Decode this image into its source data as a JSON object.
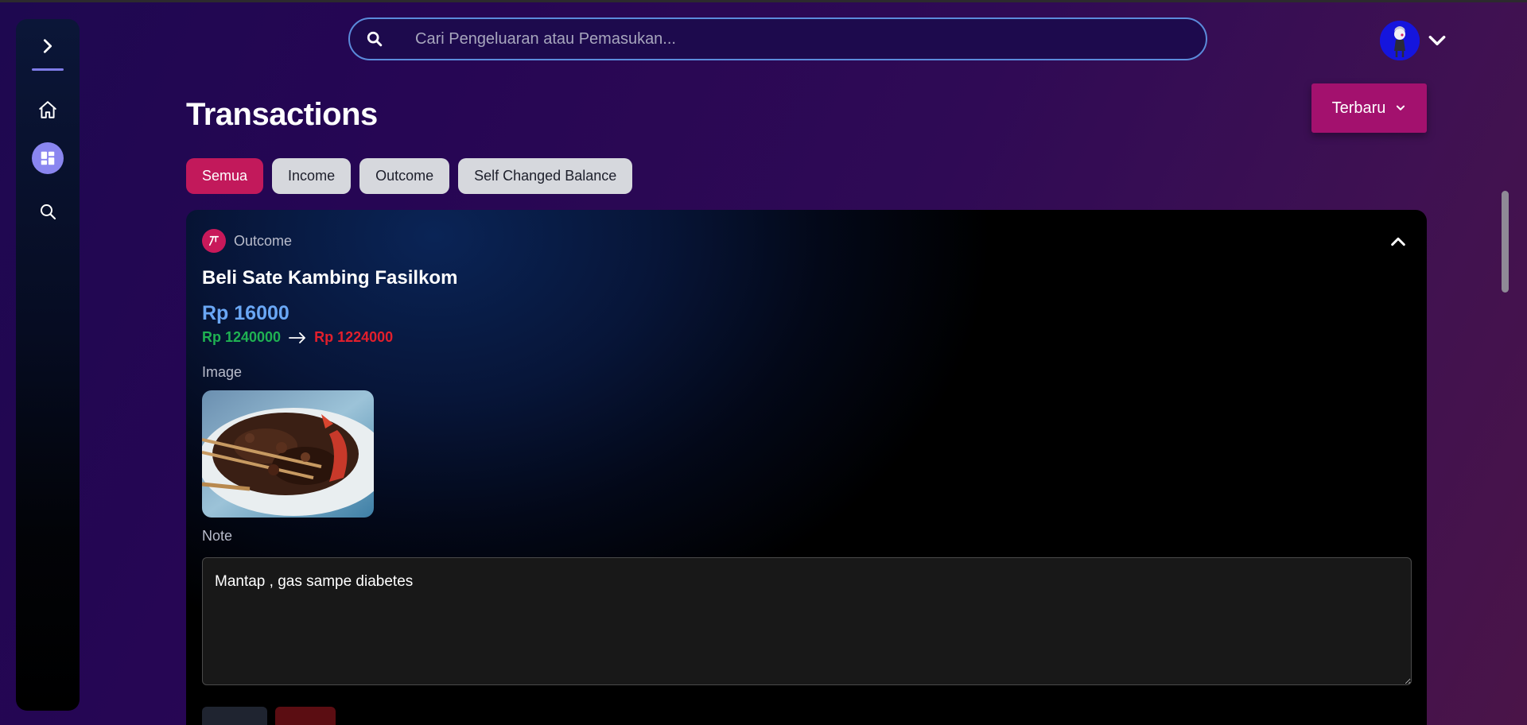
{
  "sidebar": {
    "items": [
      {
        "name": "expand",
        "icon": "chevron-right-icon"
      },
      {
        "name": "home",
        "icon": "home-icon"
      },
      {
        "name": "dashboard",
        "icon": "dashboard-icon",
        "active": true
      },
      {
        "name": "search",
        "icon": "search-icon"
      }
    ]
  },
  "search": {
    "placeholder": "Cari Pengeluaran atau Pemasukan...",
    "value": ""
  },
  "header": {
    "title": "Transactions",
    "sort_label": "Terbaru"
  },
  "filters": {
    "items": [
      "Semua",
      "Income",
      "Outcome",
      "Self Changed Balance"
    ],
    "active": "Semua"
  },
  "transaction": {
    "type": "Outcome",
    "title": "Beli Sate Kambing Fasilkom",
    "amount": "Rp 16000",
    "balance_before": "Rp 1240000",
    "balance_after": "Rp 1224000",
    "image_label": "Image",
    "note_label": "Note",
    "note": "Mantap , gas sampe diabetes"
  },
  "colors": {
    "accent": "#c2195b",
    "sort_button": "#a3116e",
    "amount": "#6aa7f5",
    "balance_before": "#1fb152",
    "balance_after": "#e21f2c",
    "sidebar_active": "#8a86f0"
  }
}
